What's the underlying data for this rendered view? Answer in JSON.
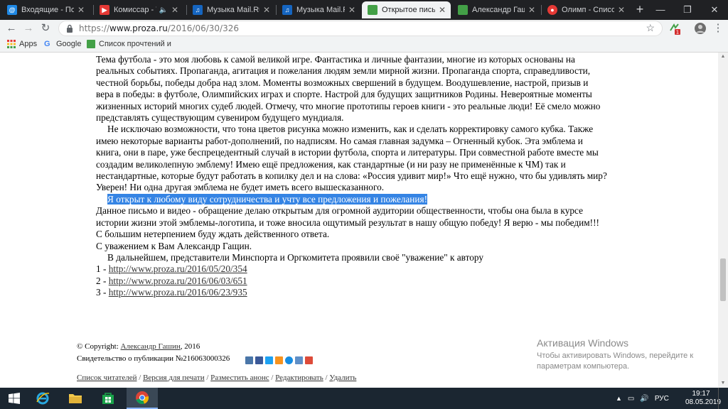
{
  "tabs": [
    {
      "title": "Входящие - Почта",
      "favicon": "mail-icon",
      "color": "#1e88e5"
    },
    {
      "title": "Комиссар - Ты",
      "favicon": "youtube-icon",
      "color": "#e53935"
    },
    {
      "title": "Музыка Mail.Ru -",
      "favicon": "mailru-music-icon",
      "color": "#1565c0"
    },
    {
      "title": "Музыка Mail.Ru -",
      "favicon": "mailru-music-icon",
      "color": "#1565c0"
    },
    {
      "title": "Открытое письмо",
      "favicon": "proza-icon",
      "color": "#43a047",
      "active": true
    },
    {
      "title": "Александр Гашин",
      "favicon": "proza-icon",
      "color": "#43a047"
    },
    {
      "title": "Олимп - Список с",
      "favicon": "olymp-icon",
      "color": "#e53935"
    }
  ],
  "address": {
    "scheme": "https://",
    "host": "www.proza.ru",
    "path": "/2016/06/30/326"
  },
  "bookmarks": {
    "apps": "Apps",
    "google": "Google",
    "reading_list": "Список прочтений и"
  },
  "article": {
    "p1": "Тема футбола - это моя любовь к самой великой игре. Фантастика и личные фантазии, многие из которых основаны на реальных событиях. Пропаганда, агитация и пожелания людям земли мирной жизни. Пропаганда спорта, справедливости, честной борьбы, победы добра над злом. Моменты возможных свершений в будущем. Воодушевление, настрой, призыв и вера в победы: в футболе, Олимпийских играх и спорте. Настрой для будущих защитников Родины. Невероятные моменты жизненных историй многих судеб людей. Отмечу, что многие прототипы героев книги - это реальные люди! Её смело можно представлять существующим сувениром будущего мундиаля.",
    "p2": "Не исключаю возможности, что тона цветов рисунка можно изменить, как и сделать корректировку самого кубка. Также имею некоторые варианты работ-дополнений, по надписям. Но самая главная задумка – Огненный кубок. Эта эмблема и книга, они в паре, уже беспрецедентный случай в истории футбола, спорта и литературы. При совместной работе вместе мы создадим великолепную эмблему! Имею ещё предложения, как стандартные (и ни разу не применённые к ЧМ) так и нестандартные, которые будут работать в копилку дел и на слова: «Россия удивит мир!» Что ещё нужно, что бы удивлять мир? Уверен! Ни одна другая эмблема не будет иметь всего вышесказанного.",
    "p3": "Я открыт к любому виду сотрудничества и учту все предложения и пожелания!",
    "p4": "Данное письмо и видео - обращение делаю открытым для огромной аудитории общественности, чтобы она была в курсе истории жизни этой эмблемы-логотипа, и тоже вносила ощутимый результат в нашу общую победу! Я верю - мы победим!!!",
    "p5": "С большим нетерпением буду ждать действенного ответа.",
    "p6": "С уважением к Вам Александр Гащин.",
    "p7": "В дальнейшем, представители Минспорта и Оргкомитета проявили своё \"уважение\" к автору",
    "links": [
      {
        "num": "1 - ",
        "url": "http://www.proza.ru/2016/05/20/354"
      },
      {
        "num": "2 - ",
        "url": "http://www.proza.ru/2016/06/03/651"
      },
      {
        "num": "3 - ",
        "url": "http://www.proza.ru/2016/06/23/935"
      }
    ]
  },
  "footer": {
    "copyright_prefix": "© Copyright: ",
    "author": "Александр Гашин",
    "year": ", 2016",
    "certificate": "Свидетельство о публикации №216063000326",
    "links": [
      "Список читателей",
      "Версия для печати",
      "Разместить анонс",
      "Редактировать",
      "Удалить"
    ]
  },
  "watermark": {
    "title": "Активация Windows",
    "subtitle": "Чтобы активировать Windows, перейдите к параметрам компьютера."
  },
  "taskbar": {
    "lang": "РУС",
    "time": "19:17",
    "date": "08.05.2019"
  }
}
